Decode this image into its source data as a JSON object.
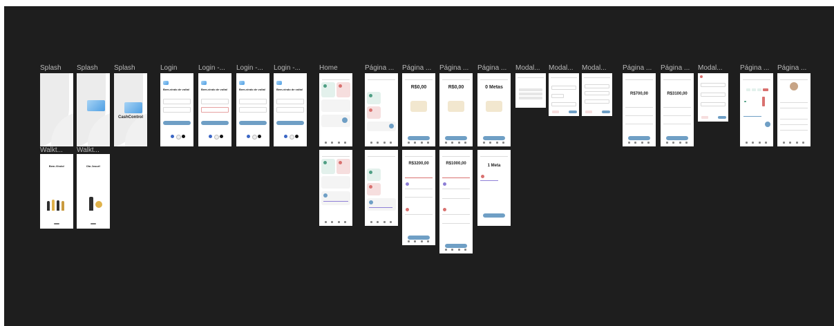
{
  "frame_labels": {
    "splash": "Splash",
    "walkthrough": "Walkt...",
    "login": "Login",
    "login_ellipsis": "Login -...",
    "home": "Home",
    "pagina": "Página ...",
    "modal": "Modal..."
  },
  "splash": {
    "brand": "CashControl"
  },
  "login": {
    "title": "Bem-vindo de volta!"
  },
  "walkthrough": {
    "screen1_title": "Bem-Vindo!",
    "screen2_title": "Ola Josué!"
  },
  "pages": {
    "balance_zero": "R$0,00",
    "goals_zero": "0 Metas",
    "balance_700": "R$700,00",
    "balance_3100": "R$3100,00",
    "balance_3200": "R$3200,00",
    "balance_1000": "R$1000,00",
    "goals_one": "1 Meta"
  },
  "colors": {
    "canvas": "#1e1e1e",
    "label": "#b9b9b9",
    "accent": "#6f9fc5",
    "income": "#e3f1ec",
    "expense": "#f6dede",
    "green": "#4f9f84",
    "red": "#d9716f"
  }
}
